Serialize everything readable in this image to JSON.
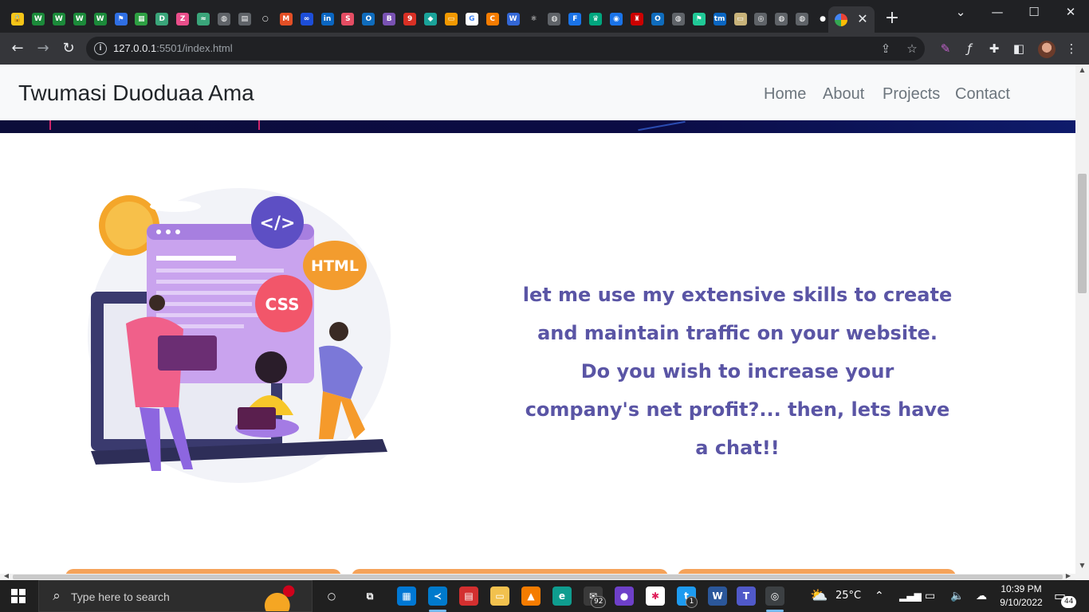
{
  "browser": {
    "tab_icons": [
      {
        "name": "bookmark-lock-icon",
        "glyph": "🔒",
        "color": "#f5c518"
      },
      {
        "name": "wordle-icon",
        "glyph": "W",
        "color": "#1b8a3a"
      },
      {
        "name": "wordle-icon",
        "glyph": "W",
        "color": "#1b8a3a"
      },
      {
        "name": "wordle-icon",
        "glyph": "W",
        "color": "#1b8a3a"
      },
      {
        "name": "wordle-icon",
        "glyph": "W",
        "color": "#1b8a3a"
      },
      {
        "name": "flag-icon",
        "glyph": "⚑",
        "color": "#2f6fe4"
      },
      {
        "name": "calendar-icon",
        "glyph": "▦",
        "color": "#2ea043"
      },
      {
        "name": "d-app-icon",
        "glyph": "D",
        "color": "#3aa57a"
      },
      {
        "name": "zb-icon",
        "glyph": "Z",
        "color": "#e94e8a"
      },
      {
        "name": "code-icon",
        "glyph": "≈",
        "color": "#3aa57a"
      },
      {
        "name": "globe-icon",
        "glyph": "◍",
        "color": "#5f6368"
      },
      {
        "name": "doc-icon",
        "glyph": "▤",
        "color": "#5f6368"
      },
      {
        "name": "circle-icon",
        "glyph": "○",
        "color": "#202124"
      },
      {
        "name": "mo-icon",
        "glyph": "M",
        "color": "#e34f26"
      },
      {
        "name": "loop-icon",
        "glyph": "∞",
        "color": "#1d4ed8"
      },
      {
        "name": "linkedin-icon",
        "glyph": "in",
        "color": "#0a66c2"
      },
      {
        "name": "scribd-icon",
        "glyph": "S",
        "color": "#e44d63"
      },
      {
        "name": "outlook-icon",
        "glyph": "O",
        "color": "#0f6cbd"
      },
      {
        "name": "bootstrap-icon",
        "glyph": "B",
        "color": "#7952b3"
      },
      {
        "name": "nine-icon",
        "glyph": "9",
        "color": "#d93025"
      },
      {
        "name": "diamond-icon",
        "glyph": "◆",
        "color": "#1aa39a"
      },
      {
        "name": "folder-icon",
        "glyph": "▭",
        "color": "#f29900"
      },
      {
        "name": "google-icon",
        "glyph": "G",
        "color": "#ffffff"
      },
      {
        "name": "shop-icon",
        "glyph": "C",
        "color": "#f57c00"
      },
      {
        "name": "w-icon",
        "glyph": "W",
        "color": "#3367d6"
      },
      {
        "name": "react-icon",
        "glyph": "⚛",
        "color": "#202124"
      },
      {
        "name": "globe-icon",
        "glyph": "◍",
        "color": "#5f6368"
      },
      {
        "name": "focus-icon",
        "glyph": "F",
        "color": "#1a73e8"
      },
      {
        "name": "crown-icon",
        "glyph": "♛",
        "color": "#00a67e"
      },
      {
        "name": "reddit-icon",
        "glyph": "◉",
        "color": "#1a73e8"
      },
      {
        "name": "redhat-icon",
        "glyph": "♜",
        "color": "#cc0000"
      },
      {
        "name": "outlook-icon",
        "glyph": "O",
        "color": "#0f6cbd"
      },
      {
        "name": "globe-icon",
        "glyph": "◍",
        "color": "#5f6368"
      },
      {
        "name": "flag-icon",
        "glyph": "⚑",
        "color": "#20c997"
      },
      {
        "name": "tm-icon",
        "glyph": "tm",
        "color": "#0a66c2"
      },
      {
        "name": "card-icon",
        "glyph": "▭",
        "color": "#c8b37a"
      },
      {
        "name": "chrome-icon",
        "glyph": "◎",
        "color": "#5f6368"
      },
      {
        "name": "globe-icon",
        "glyph": "◍",
        "color": "#5f6368"
      },
      {
        "name": "globe-icon",
        "glyph": "◍",
        "color": "#5f6368"
      },
      {
        "name": "github-icon",
        "glyph": "●",
        "color": "#202124"
      }
    ],
    "active_tab_close": "✕",
    "new_tab": "+",
    "window_controls": [
      "⌄",
      "—",
      "☐",
      "✕"
    ],
    "url_host": "127.0.0.1",
    "url_rest": ":5501/index.html"
  },
  "page": {
    "brand": "Twumasi Duoduaa Ama",
    "nav": [
      "Home",
      "About",
      "Projects",
      "Contact"
    ],
    "illustration": {
      "code_tag": "</>",
      "html_tag": "HTML",
      "css_tag": "CSS"
    },
    "pitch": "let me use my extensive skills to create and maintain traffic on your website. Do you wish to increase your company's net profit?... then, lets have a chat!!",
    "colors": {
      "pitch_text": "#5a55a5",
      "card_accent": "#f5a35a",
      "hero_strip": "#0c0d3a"
    }
  },
  "taskbar": {
    "search_placeholder": "Type here to search",
    "apps": [
      {
        "name": "cortana-icon",
        "glyph": "○",
        "color": "transparent"
      },
      {
        "name": "task-view-icon",
        "glyph": "⧉",
        "color": "transparent"
      },
      {
        "name": "store-icon",
        "glyph": "▦",
        "color": "#0078d4"
      },
      {
        "name": "vscode-icon",
        "glyph": "≺",
        "color": "#007acc"
      },
      {
        "name": "pdf-icon",
        "glyph": "▤",
        "color": "#d32f2f"
      },
      {
        "name": "file-explorer-icon",
        "glyph": "▭",
        "color": "#f2c14e"
      },
      {
        "name": "vlc-icon",
        "glyph": "▲",
        "color": "#f57c00"
      },
      {
        "name": "edge-icon",
        "glyph": "e",
        "color": "#0f9d8f"
      },
      {
        "name": "mail-icon",
        "glyph": "✉",
        "color": "#3a3a3a"
      },
      {
        "name": "github-desktop-icon",
        "glyph": "●",
        "color": "#6e40c9"
      },
      {
        "name": "slack-icon",
        "glyph": "✱",
        "color": "#ffffff"
      },
      {
        "name": "twitter-icon",
        "glyph": "t",
        "color": "#1d9bf0"
      },
      {
        "name": "word-icon",
        "glyph": "W",
        "color": "#2b579a"
      },
      {
        "name": "teams-icon",
        "glyph": "T",
        "color": "#5059c9"
      },
      {
        "name": "chrome-icon",
        "glyph": "◎",
        "color": "#3c4043"
      }
    ],
    "mail_badge": "92",
    "twitter_badge": "1",
    "weather_icon": "⛅",
    "temperature": "25°C",
    "time": "10:39 PM",
    "date": "9/10/2022",
    "notifications": "44"
  }
}
